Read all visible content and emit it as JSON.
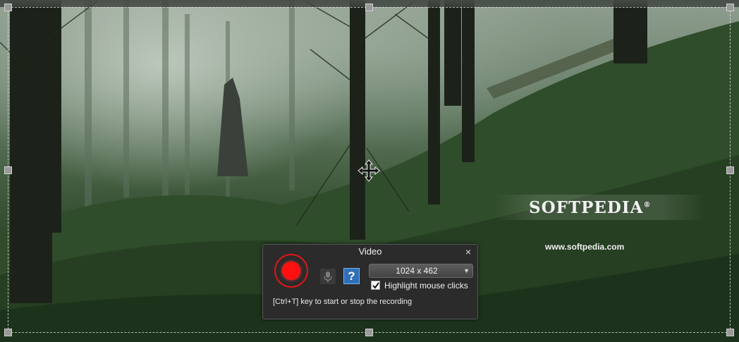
{
  "watermark": {
    "brand": "SOFTPEDIA",
    "registered": "®",
    "url": "www.softpedia.com"
  },
  "dialog": {
    "title": "Video",
    "close_glyph": "×",
    "record_button": "record-icon",
    "mic_button": "microphone-icon",
    "help_label": "?",
    "resolution_value": "1024 x 462",
    "resolution_arrow": "▼",
    "highlight_clicks_label": "Highlight mouse clicks",
    "highlight_clicks_checked": true,
    "hint": "[Ctrl+T] key to start or stop the recording"
  },
  "colors": {
    "record_red": "#ff1010",
    "dialog_bg": "#2b2b2b",
    "help_blue": "#2f6fb8"
  }
}
